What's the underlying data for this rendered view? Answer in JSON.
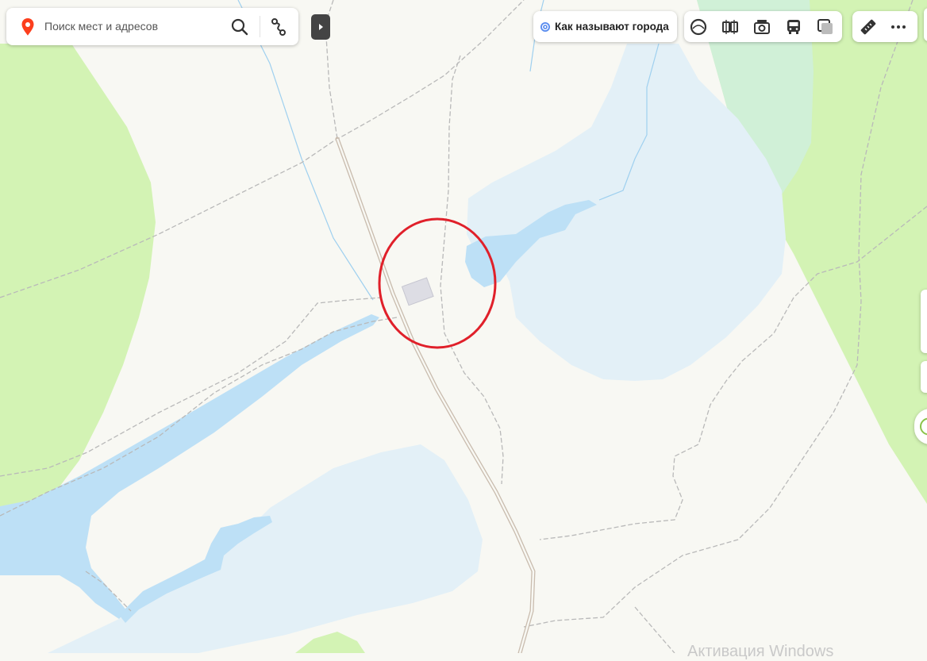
{
  "search": {
    "placeholder": "Поиск мест и адресов"
  },
  "chip": {
    "label": "Как называют города"
  },
  "layers": [
    "panorama-icon",
    "photos-icon",
    "camera-icon",
    "transit-icon",
    "map-layer-icon"
  ],
  "tools": [
    "ruler-icon",
    "more-icon"
  ],
  "marker": {
    "color": "#e0202a",
    "label": "highlight-circle"
  },
  "watermark": {
    "text": "Активация Windows"
  },
  "colors": {
    "background": "#f8f8f3",
    "forest": "#d3f3b4",
    "water": "#bde0f6",
    "lake_light": "#e3f0f7",
    "road": "#c9bcae",
    "border": "#b9b9b9",
    "accent": "#e0202a"
  }
}
